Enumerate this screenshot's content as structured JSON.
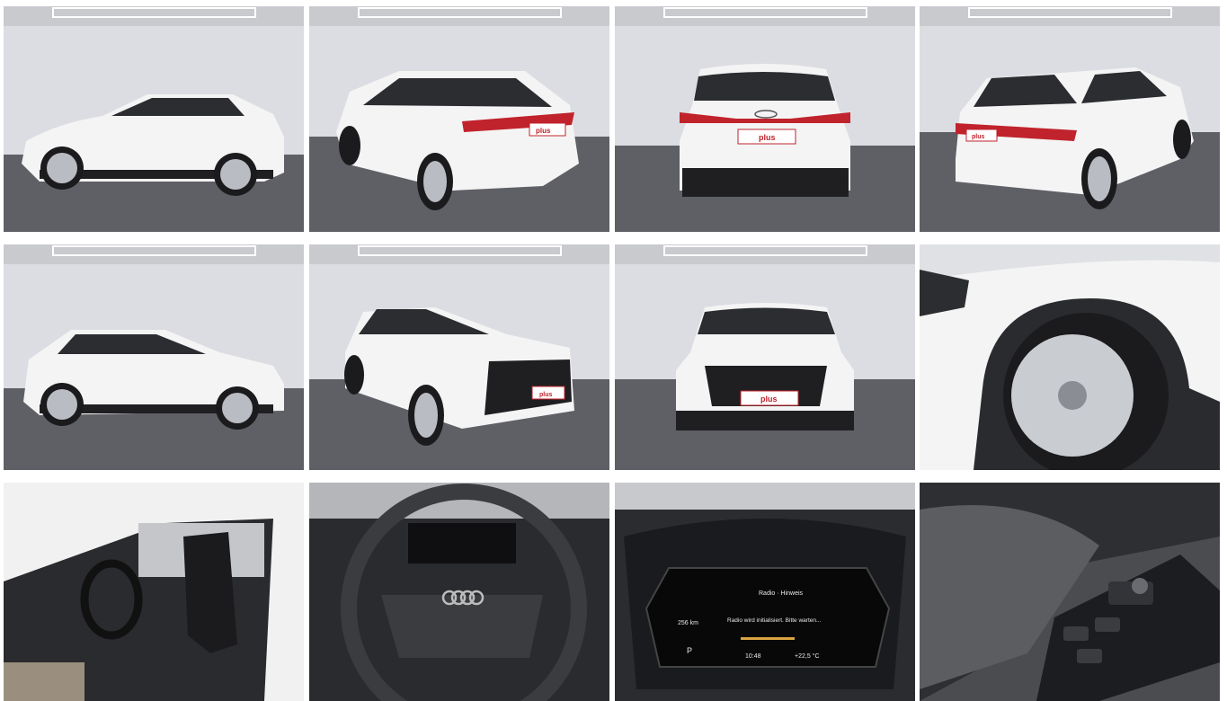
{
  "gallery": {
    "tiles": [
      {
        "id": 1,
        "view": "side-left"
      },
      {
        "id": 2,
        "view": "rear-three-quarter-left"
      },
      {
        "id": 3,
        "view": "rear"
      },
      {
        "id": 4,
        "view": "rear-three-quarter-right"
      },
      {
        "id": 5,
        "view": "side-right"
      },
      {
        "id": 6,
        "view": "front-three-quarter-left"
      },
      {
        "id": 7,
        "view": "front"
      },
      {
        "id": 8,
        "view": "wheel-detail"
      },
      {
        "id": 9,
        "view": "interior-driver-seat"
      },
      {
        "id": 10,
        "view": "steering-wheel"
      },
      {
        "id": 11,
        "view": "instrument-cluster"
      },
      {
        "id": 12,
        "view": "door-panel-controls"
      }
    ],
    "plate_text": "plus",
    "cluster": {
      "range": "256 km",
      "mode_label": "Radio · Hinweis",
      "message": "Radio wird initialisiert. Bitte warten...",
      "time": "10:48",
      "temperature": "+22,5 °C",
      "gear": "P"
    },
    "colors": {
      "car_body": "#f4f4f4",
      "studio_wall": "#dcdde2",
      "studio_floor": "#5f6066",
      "tail_light": "#c0232c",
      "interior": "#2a2b2e"
    }
  }
}
